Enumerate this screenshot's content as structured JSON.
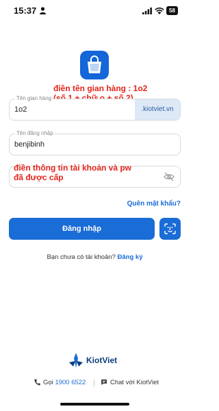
{
  "status_bar": {
    "time": "15:37",
    "battery": "58"
  },
  "annotations": {
    "store_note_line1": "điền tên gian hàng : 1o2",
    "store_note_line2": "(số 1 + chữ o + số 2)",
    "account_note_line1": "điền thông tin tài khoản và pw",
    "account_note_line2": "đã được cấp"
  },
  "form": {
    "store_label": "Tên gian hàng",
    "store_value": "1o2",
    "store_domain": ".kiotviet.vn",
    "username_label": "Tên đăng nhập",
    "username_value": "benjibinh",
    "forgot_password": "Quên mật khẩu?",
    "login_button": "Đăng nhập"
  },
  "signup": {
    "prompt": "Bạn chưa có tài khoản?",
    "link": "Đăng ký"
  },
  "footer": {
    "brand": "KiotViet",
    "call_label": "Gọi",
    "phone": "1900 6522",
    "chat_label": "Chat với KiotViet"
  },
  "colors": {
    "primary": "#1a6cd6",
    "annotation": "#e1251b",
    "domain_bg": "#dde9f7"
  }
}
